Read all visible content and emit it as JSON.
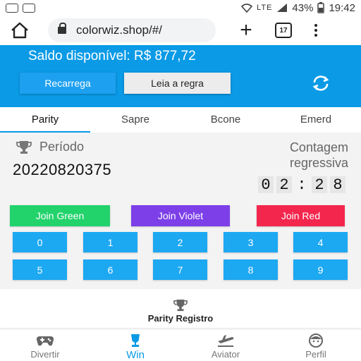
{
  "status_bar": {
    "battery": "43%",
    "time": "19:42",
    "network": "LTE"
  },
  "browser": {
    "url": "colorwiz.shop/#/",
    "tab_count": "17"
  },
  "header": {
    "balance": "Saldo disponível: R$ 877,72",
    "recharge_label": "Recarrega",
    "rules_label": "Leia a regra"
  },
  "game_tabs": [
    {
      "label": "Parity",
      "active": true
    },
    {
      "label": "Sapre",
      "active": false
    },
    {
      "label": "Bcone",
      "active": false
    },
    {
      "label": "Emerd",
      "active": false
    }
  ],
  "game": {
    "period_label": "Período",
    "period_value": "20220820375",
    "countdown_label": "Contagem regressiva",
    "countdown_digits": [
      "0",
      "2",
      ":",
      "2",
      "8"
    ],
    "join_green": "Join Green",
    "join_violet": "Join Violet",
    "join_red": "Join Red",
    "numbers": [
      "0",
      "1",
      "2",
      "3",
      "4",
      "5",
      "6",
      "7",
      "8",
      "9"
    ]
  },
  "record": {
    "title": "Parity Registro"
  },
  "bottom_nav": [
    {
      "label": "Divertir",
      "icon": "gamepad-icon",
      "active": false
    },
    {
      "label": "Win",
      "icon": "trophy-cup-icon",
      "active": true
    },
    {
      "label": "Aviator",
      "icon": "airplane-icon",
      "active": false
    },
    {
      "label": "Perfil",
      "icon": "face-icon",
      "active": false
    }
  ],
  "colors": {
    "primary_blue": "#0a9ae6",
    "green": "#22d36b",
    "violet": "#7c3fe8",
    "red": "#f3264d",
    "number_blue": "#1da8f2"
  }
}
